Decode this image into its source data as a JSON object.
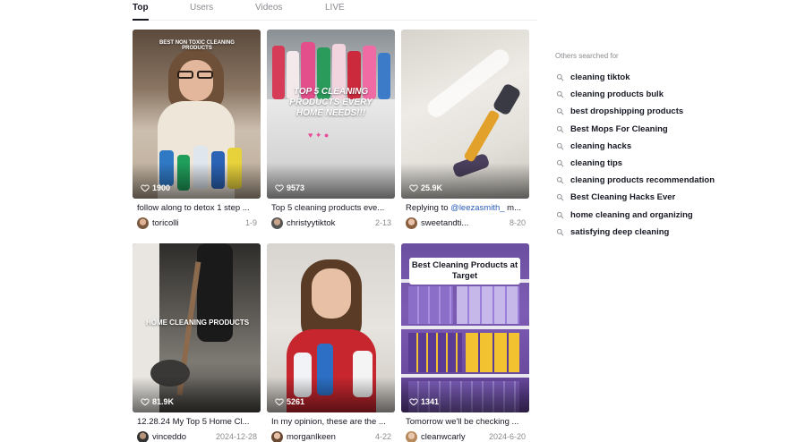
{
  "tabs": [
    {
      "label": "Top",
      "active": true
    },
    {
      "label": "Users",
      "active": false
    },
    {
      "label": "Videos",
      "active": false
    },
    {
      "label": "LIVE",
      "active": false
    }
  ],
  "videos": [
    {
      "likes": "1900",
      "caption": "follow along to detox 1 step ...",
      "caption_mention": "",
      "caption_tail": "",
      "username": "toricolli",
      "date": "1-9",
      "overlay": "BEST NON TOXIC CLEANING PRODUCTS"
    },
    {
      "likes": "9573",
      "caption": "Top 5 cleaning products eve...",
      "caption_mention": "",
      "caption_tail": "",
      "username": "christyytiktok",
      "date": "2-13",
      "overlay": "TOP 5 CLEANING PRODUCTS EVERY HOME NEEDS!!!"
    },
    {
      "likes": "25.9K",
      "caption": "Replying to ",
      "caption_mention": "@leezasmith_",
      "caption_tail": " m...",
      "username": "sweetandti...",
      "date": "8-20",
      "overlay": ""
    },
    {
      "likes": "81.9K",
      "caption": "12.28.24 My Top 5 Home Cl...",
      "caption_mention": "",
      "caption_tail": "",
      "username": "vinceddo",
      "date": "2024-12-28",
      "overlay": "HOME CLEANING PRODUCTS"
    },
    {
      "likes": "5261",
      "caption": "In my opinion, these are the ...",
      "caption_mention": "",
      "caption_tail": "",
      "username": "morganlkeen",
      "date": "4-22",
      "overlay": ""
    },
    {
      "likes": "1341",
      "caption": "Tomorrow we'll be checking ...",
      "caption_mention": "",
      "caption_tail": "",
      "username": "cleanwcarly",
      "date": "2024-6-20",
      "overlay": "Best Cleaning Products at Target"
    }
  ],
  "sidebar": {
    "title": "Others searched for",
    "items": [
      "cleaning tiktok",
      "cleaning products bulk",
      "best dropshipping products",
      "Best Mops For Cleaning",
      "cleaning hacks",
      "cleaning tips",
      "cleaning products recommendation",
      "Best Cleaning Hacks Ever",
      "home cleaning and organizing",
      "satisfying deep cleaning"
    ]
  }
}
